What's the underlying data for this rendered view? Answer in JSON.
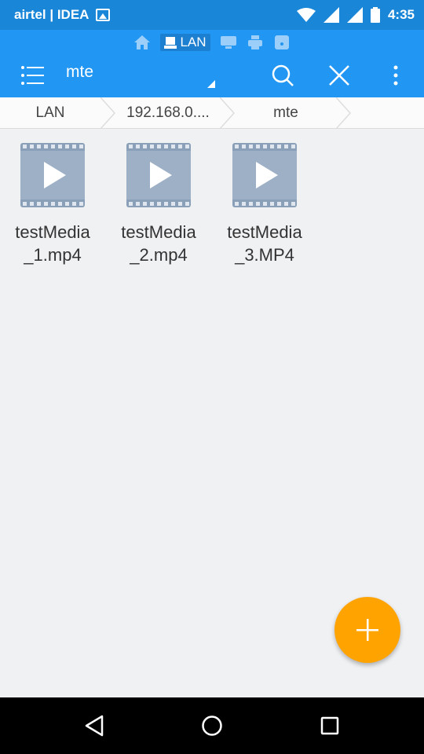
{
  "status_bar": {
    "carrier": "airtel | IDEA",
    "time": "4:35"
  },
  "quick_nav": {
    "active_label": "LAN"
  },
  "toolbar": {
    "title": "mte"
  },
  "breadcrumb": {
    "items": [
      "LAN",
      "192.168.0....",
      "mte"
    ]
  },
  "files": [
    {
      "name": "testMedia\n_1.mp4",
      "icon": "video-file-icon"
    },
    {
      "name": "testMedia\n_2.mp4",
      "icon": "video-file-icon"
    },
    {
      "name": "testMedia\n_3.MP4",
      "icon": "video-file-icon"
    }
  ],
  "colors": {
    "accent": "#2196f3",
    "status_bar": "#1a86d8",
    "fab": "#ffa300",
    "video_icon": "#8aa0b8"
  }
}
